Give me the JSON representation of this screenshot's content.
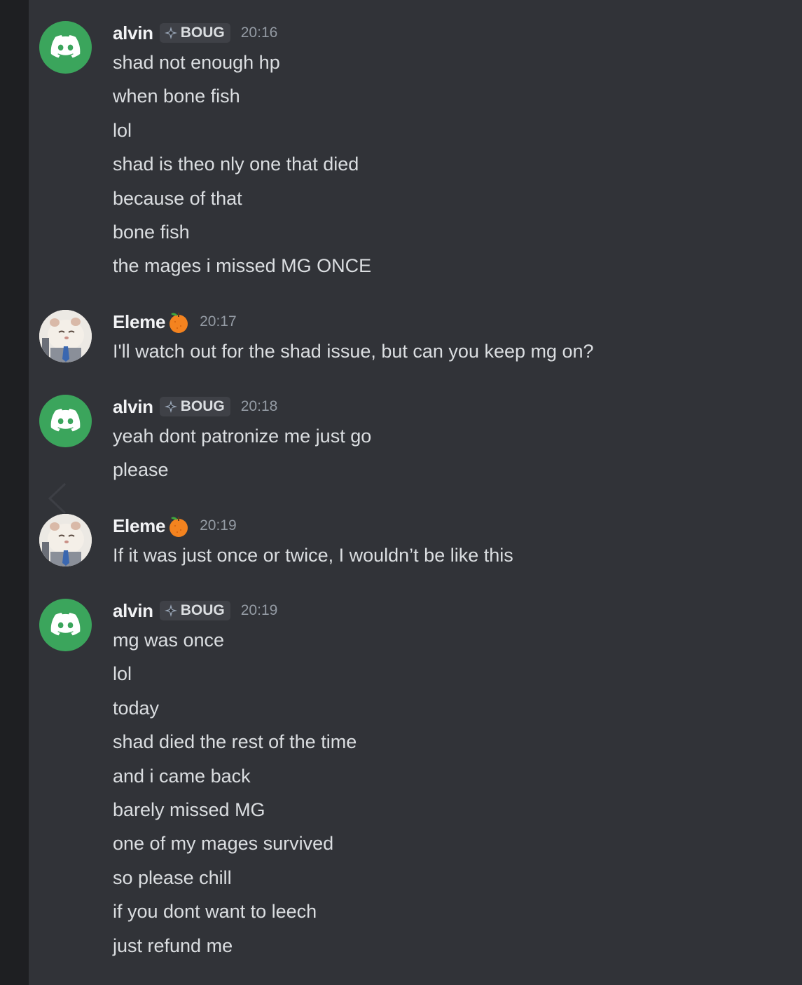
{
  "colors": {
    "background": "#313338",
    "left_strip": "#1e1f22",
    "discord_avatar": "#3ba55c",
    "username": "#f2f3f5",
    "message_text": "#dbdee1",
    "timestamp": "#949ba4",
    "tag_bg": "#3f4147"
  },
  "messages": [
    {
      "author": "alvin",
      "avatar": "discord-logo-icon",
      "tag": "BOUG",
      "time": "20:16",
      "lines": [
        "shad not enough hp",
        "when bone fish",
        "lol",
        "shad is theo nly one that died",
        "because of that",
        "bone fish",
        "the mages i missed MG ONCE"
      ]
    },
    {
      "author": "Eleme",
      "avatar": "hamster-photo",
      "badge": "orange-emoji-icon",
      "time": "20:17",
      "lines": [
        "I'll watch out for the shad issue, but can you keep mg on?"
      ]
    },
    {
      "author": "alvin",
      "avatar": "discord-logo-icon",
      "tag": "BOUG",
      "time": "20:18",
      "lines": [
        "yeah dont patronize me just go",
        "please"
      ]
    },
    {
      "author": "Eleme",
      "avatar": "hamster-photo",
      "badge": "orange-emoji-icon",
      "time": "20:19",
      "lines": [
        "If it was just once or twice, I wouldn’t be like this"
      ]
    },
    {
      "author": "alvin",
      "avatar": "discord-logo-icon",
      "tag": "BOUG",
      "time": "20:19",
      "lines": [
        "mg was once",
        "lol",
        "today",
        "shad died the rest of the time",
        "and i came back",
        "barely missed MG",
        "one of my mages survived",
        "so please chill",
        "if you dont want to leech",
        "just refund me"
      ]
    }
  ]
}
